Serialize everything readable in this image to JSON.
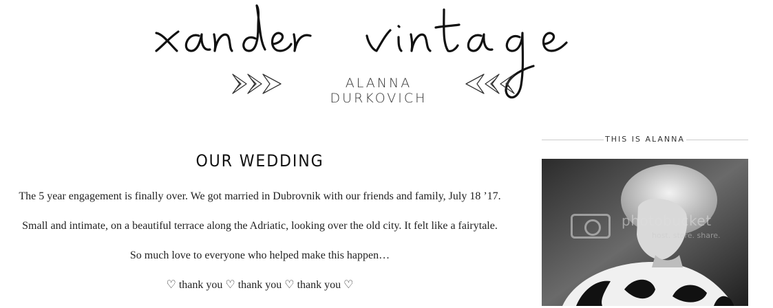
{
  "header": {
    "logo_text": "xander vintage",
    "subtitle": "ALANNA DURKOVICH"
  },
  "post": {
    "title": "OUR WEDDING",
    "paragraphs": [
      "The 5 year engagement is finally over. We got married in Dubrovnik with our friends and family, July 18 ’17.",
      "Small and intimate, on a beautiful terrace along the Adriatic, looking over the old city. It felt like a fairytale.",
      "So much love to everyone who helped make this happen…",
      "♡ thank you ♡ thank you ♡ thank you ♡"
    ]
  },
  "sidebar": {
    "widget_title": "THIS IS ALANNA",
    "watermark_text": "photobucket",
    "watermark_sub": "host. store. share."
  },
  "colors": {
    "text": "#222222",
    "divider": "#cccccc",
    "background": "#ffffff"
  }
}
